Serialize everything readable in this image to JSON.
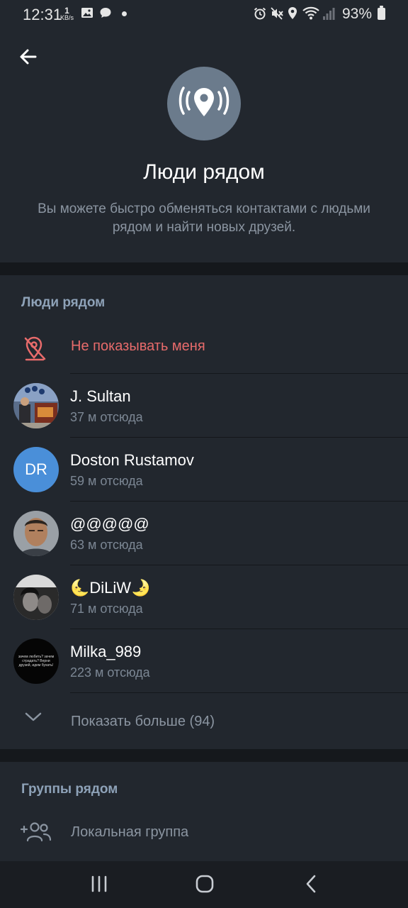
{
  "status_bar": {
    "time": "12:31",
    "net_speed_value": "1",
    "net_speed_unit": "KB/s",
    "battery": "93%",
    "icons": [
      "gallery-icon",
      "chat-icon",
      "dot",
      "alarm-icon",
      "mute-icon",
      "location-icon",
      "wifi-icon",
      "signal-icon",
      "battery-icon"
    ]
  },
  "header": {
    "title": "Люди рядом",
    "subtitle": "Вы можете быстро обменяться контактами с людьми рядом и найти новых друзей."
  },
  "people": {
    "section_title": "Люди рядом",
    "hide_label": "Не показывать меня",
    "users": [
      {
        "name": "J. Sultan",
        "distance": "37 м отсюда"
      },
      {
        "name": "Doston Rustamov",
        "distance": "59 м отсюда",
        "initials": "DR"
      },
      {
        "name": "@@@@@",
        "distance": "63 м отсюда"
      },
      {
        "name_left": "🌜",
        "name": "DiLiW",
        "name_right": "🌛",
        "distance": "71 м отсюда"
      },
      {
        "name": "Milka_989",
        "distance": "223 м отсюда",
        "avatar_text": "зачем любить? зачем страдать? Верни друзей, идем бухать!"
      }
    ],
    "show_more": "Показать больше (94)"
  },
  "groups": {
    "section_title": "Группы рядом",
    "local_group": "Локальная группа"
  },
  "colors": {
    "background": "#22272e",
    "accent_red": "#e86b6b",
    "section_title": "#8ea2b8",
    "avatar_blue": "#4a8fd9"
  }
}
